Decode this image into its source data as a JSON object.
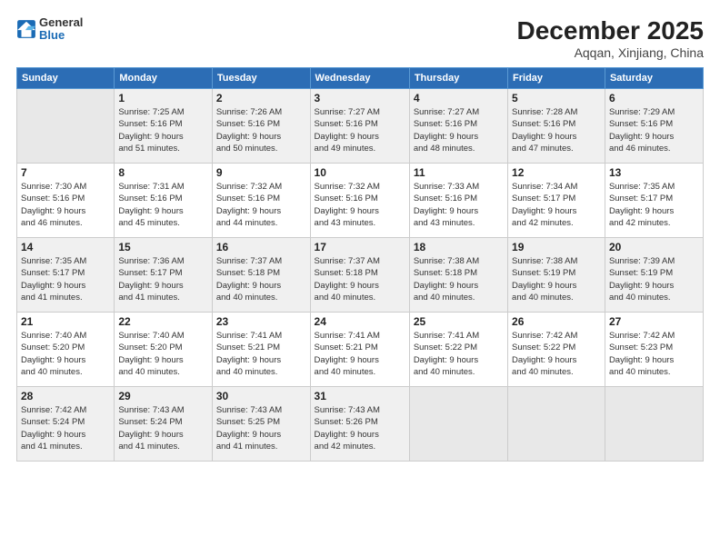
{
  "logo": {
    "general": "General",
    "blue": "Blue"
  },
  "header": {
    "month": "December 2025",
    "location": "Aqqan, Xinjiang, China"
  },
  "weekdays": [
    "Sunday",
    "Monday",
    "Tuesday",
    "Wednesday",
    "Thursday",
    "Friday",
    "Saturday"
  ],
  "weeks": [
    [
      {
        "day": "",
        "info": ""
      },
      {
        "day": "1",
        "info": "Sunrise: 7:25 AM\nSunset: 5:16 PM\nDaylight: 9 hours\nand 51 minutes."
      },
      {
        "day": "2",
        "info": "Sunrise: 7:26 AM\nSunset: 5:16 PM\nDaylight: 9 hours\nand 50 minutes."
      },
      {
        "day": "3",
        "info": "Sunrise: 7:27 AM\nSunset: 5:16 PM\nDaylight: 9 hours\nand 49 minutes."
      },
      {
        "day": "4",
        "info": "Sunrise: 7:27 AM\nSunset: 5:16 PM\nDaylight: 9 hours\nand 48 minutes."
      },
      {
        "day": "5",
        "info": "Sunrise: 7:28 AM\nSunset: 5:16 PM\nDaylight: 9 hours\nand 47 minutes."
      },
      {
        "day": "6",
        "info": "Sunrise: 7:29 AM\nSunset: 5:16 PM\nDaylight: 9 hours\nand 46 minutes."
      }
    ],
    [
      {
        "day": "7",
        "info": "Sunrise: 7:30 AM\nSunset: 5:16 PM\nDaylight: 9 hours\nand 46 minutes."
      },
      {
        "day": "8",
        "info": "Sunrise: 7:31 AM\nSunset: 5:16 PM\nDaylight: 9 hours\nand 45 minutes."
      },
      {
        "day": "9",
        "info": "Sunrise: 7:32 AM\nSunset: 5:16 PM\nDaylight: 9 hours\nand 44 minutes."
      },
      {
        "day": "10",
        "info": "Sunrise: 7:32 AM\nSunset: 5:16 PM\nDaylight: 9 hours\nand 43 minutes."
      },
      {
        "day": "11",
        "info": "Sunrise: 7:33 AM\nSunset: 5:16 PM\nDaylight: 9 hours\nand 43 minutes."
      },
      {
        "day": "12",
        "info": "Sunrise: 7:34 AM\nSunset: 5:17 PM\nDaylight: 9 hours\nand 42 minutes."
      },
      {
        "day": "13",
        "info": "Sunrise: 7:35 AM\nSunset: 5:17 PM\nDaylight: 9 hours\nand 42 minutes."
      }
    ],
    [
      {
        "day": "14",
        "info": "Sunrise: 7:35 AM\nSunset: 5:17 PM\nDaylight: 9 hours\nand 41 minutes."
      },
      {
        "day": "15",
        "info": "Sunrise: 7:36 AM\nSunset: 5:17 PM\nDaylight: 9 hours\nand 41 minutes."
      },
      {
        "day": "16",
        "info": "Sunrise: 7:37 AM\nSunset: 5:18 PM\nDaylight: 9 hours\nand 40 minutes."
      },
      {
        "day": "17",
        "info": "Sunrise: 7:37 AM\nSunset: 5:18 PM\nDaylight: 9 hours\nand 40 minutes."
      },
      {
        "day": "18",
        "info": "Sunrise: 7:38 AM\nSunset: 5:18 PM\nDaylight: 9 hours\nand 40 minutes."
      },
      {
        "day": "19",
        "info": "Sunrise: 7:38 AM\nSunset: 5:19 PM\nDaylight: 9 hours\nand 40 minutes."
      },
      {
        "day": "20",
        "info": "Sunrise: 7:39 AM\nSunset: 5:19 PM\nDaylight: 9 hours\nand 40 minutes."
      }
    ],
    [
      {
        "day": "21",
        "info": "Sunrise: 7:40 AM\nSunset: 5:20 PM\nDaylight: 9 hours\nand 40 minutes."
      },
      {
        "day": "22",
        "info": "Sunrise: 7:40 AM\nSunset: 5:20 PM\nDaylight: 9 hours\nand 40 minutes."
      },
      {
        "day": "23",
        "info": "Sunrise: 7:41 AM\nSunset: 5:21 PM\nDaylight: 9 hours\nand 40 minutes."
      },
      {
        "day": "24",
        "info": "Sunrise: 7:41 AM\nSunset: 5:21 PM\nDaylight: 9 hours\nand 40 minutes."
      },
      {
        "day": "25",
        "info": "Sunrise: 7:41 AM\nSunset: 5:22 PM\nDaylight: 9 hours\nand 40 minutes."
      },
      {
        "day": "26",
        "info": "Sunrise: 7:42 AM\nSunset: 5:22 PM\nDaylight: 9 hours\nand 40 minutes."
      },
      {
        "day": "27",
        "info": "Sunrise: 7:42 AM\nSunset: 5:23 PM\nDaylight: 9 hours\nand 40 minutes."
      }
    ],
    [
      {
        "day": "28",
        "info": "Sunrise: 7:42 AM\nSunset: 5:24 PM\nDaylight: 9 hours\nand 41 minutes."
      },
      {
        "day": "29",
        "info": "Sunrise: 7:43 AM\nSunset: 5:24 PM\nDaylight: 9 hours\nand 41 minutes."
      },
      {
        "day": "30",
        "info": "Sunrise: 7:43 AM\nSunset: 5:25 PM\nDaylight: 9 hours\nand 41 minutes."
      },
      {
        "day": "31",
        "info": "Sunrise: 7:43 AM\nSunset: 5:26 PM\nDaylight: 9 hours\nand 42 minutes."
      },
      {
        "day": "",
        "info": ""
      },
      {
        "day": "",
        "info": ""
      },
      {
        "day": "",
        "info": ""
      }
    ]
  ]
}
